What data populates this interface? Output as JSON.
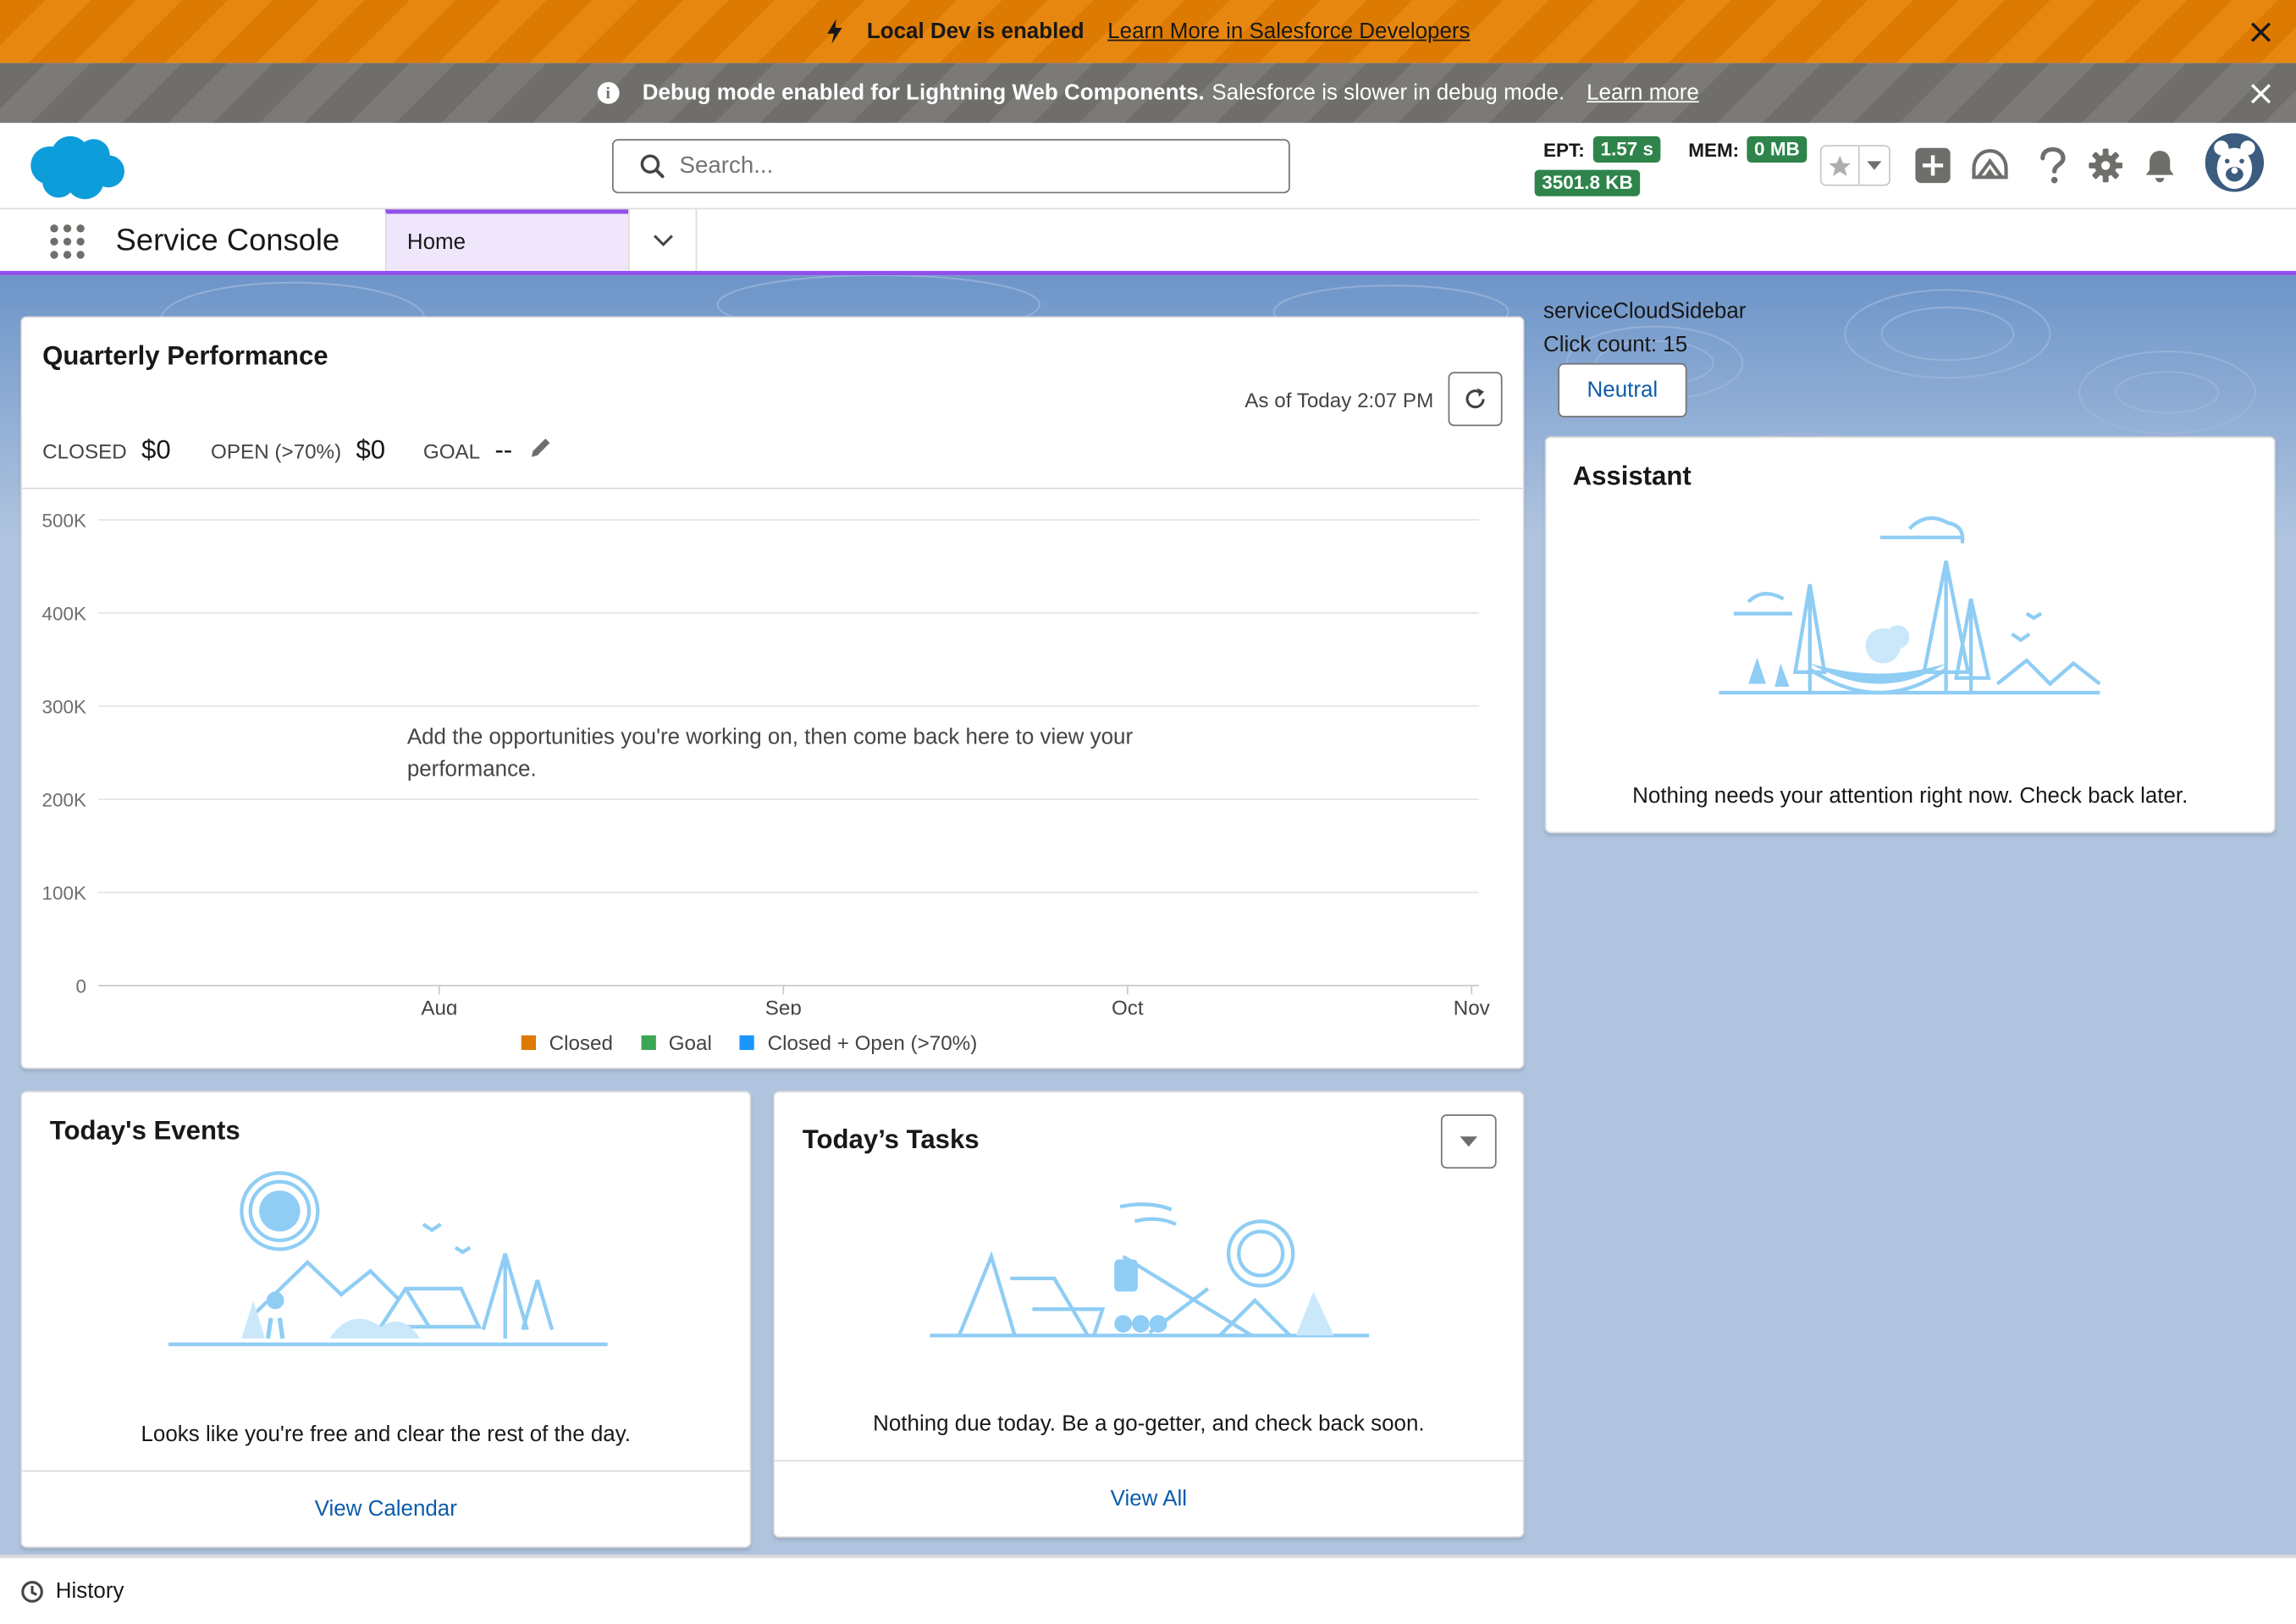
{
  "banners": {
    "dev": {
      "title": "Local Dev is enabled",
      "link": "Learn More in Salesforce Developers"
    },
    "debug": {
      "title": "Debug mode enabled for Lightning Web Components.",
      "message": "Salesforce is slower in debug mode.",
      "link": "Learn more"
    }
  },
  "header": {
    "search_placeholder": "Search...",
    "ept_label": "EPT:",
    "ept_value": "1.57 s",
    "mem_label": "MEM:",
    "mem_value": "0 MB",
    "size_value": "3501.8 KB"
  },
  "nav": {
    "app_name": "Service Console",
    "tabs": [
      {
        "label": "Home"
      }
    ]
  },
  "quarterly": {
    "title": "Quarterly Performance",
    "as_of": "As of Today 2:07 PM",
    "metrics": [
      {
        "label": "CLOSED",
        "value": "$0"
      },
      {
        "label": "OPEN (>70%)",
        "value": "$0"
      },
      {
        "label": "GOAL",
        "value": "--"
      }
    ],
    "empty_message": "Add the opportunities you're working on, then come back here to view your performance."
  },
  "chart_data": {
    "type": "line",
    "title": "",
    "xlabel": "",
    "ylabel": "",
    "x_ticks": [
      "Aug",
      "Sep",
      "Oct",
      "Nov"
    ],
    "y_ticks": [
      "0",
      "100K",
      "200K",
      "300K",
      "400K",
      "500K"
    ],
    "ylim": [
      0,
      500000
    ],
    "grid": true,
    "legend_position": "bottom",
    "series": [
      {
        "name": "Closed",
        "color": "#dd7a01",
        "values": []
      },
      {
        "name": "Goal",
        "color": "#3ba755",
        "values": []
      },
      {
        "name": "Closed + Open (>70%)",
        "color": "#1b96ff",
        "values": []
      }
    ]
  },
  "events": {
    "title": "Today's Events",
    "empty_message": "Looks like you're free and clear the rest of the day.",
    "footer_link": "View Calendar"
  },
  "tasks": {
    "title": "Today’s Tasks",
    "empty_message": "Nothing due today. Be a go-getter, and check back soon.",
    "footer_link": "View All"
  },
  "sidebar": {
    "title": "serviceCloudSidebar",
    "click_count": "Click count: 15",
    "neutral_button": "Neutral"
  },
  "assistant": {
    "title": "Assistant",
    "empty_message": "Nothing needs your attention right now. Check back later."
  },
  "utility": {
    "history_label": "History"
  },
  "colors": {
    "dev_banner": "#dd7a01",
    "debug_banner": "#706e6b",
    "nav_accent": "#9050e9",
    "badge_green": "#2e844a",
    "link_blue": "#0b5cab",
    "workspace_bg": "#b0c4df",
    "illustration": "#8fcdf4"
  }
}
